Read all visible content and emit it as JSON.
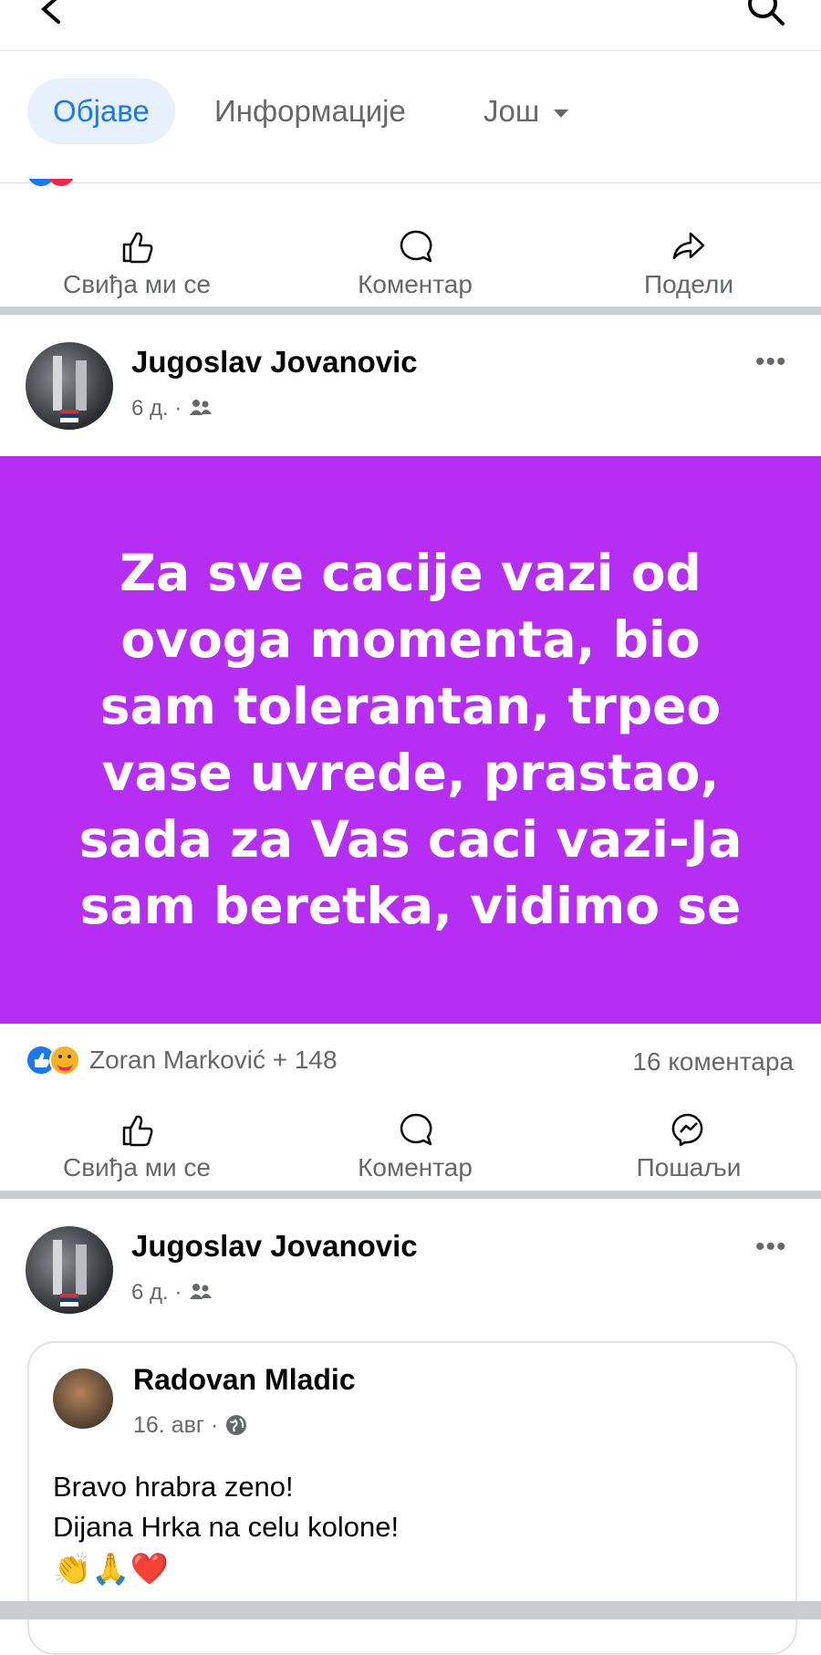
{
  "tabs": {
    "posts": "Објаве",
    "about": "Информације",
    "more": "Још"
  },
  "prev_post": {
    "actions": {
      "like": "Свиђа ми се",
      "comment": "Коментар",
      "share": "Подели"
    }
  },
  "post1": {
    "author": "Jugoslav Jovanovic",
    "time": "6 д.",
    "dot": "·",
    "more": "•••",
    "text": "Za sve cacije vazi od ovoga momenta, bio sam tolerantan, trpeo vase uvrede, prastao, sada za Vas caci vazi-Ja sam beretka, vidimo se",
    "reactions_summary": "Zoran Marković + 148",
    "comments_count": "16 коментара",
    "actions": {
      "like": "Свиђа ми се",
      "comment": "Коментар",
      "send": "Пошаљи"
    },
    "colors": {
      "background": "#b62ef3"
    }
  },
  "post2": {
    "author": "Jugoslav Jovanovic",
    "time": "6 д.",
    "dot": "·",
    "more": "•••",
    "shared": {
      "author": "Radovan Mladic",
      "time": "16. авг",
      "dot": "·",
      "line1": "Bravo hrabra zeno!",
      "line2": "Dijana Hrka na celu kolone!",
      "emojis": "👏🙏❤️"
    }
  },
  "icons": [
    "back-icon",
    "search-icon",
    "caret-down-icon",
    "like-icon",
    "comment-icon",
    "share-icon",
    "messenger-icon",
    "friends-icon",
    "globe-icon",
    "like-reaction-icon",
    "care-reaction-icon"
  ]
}
